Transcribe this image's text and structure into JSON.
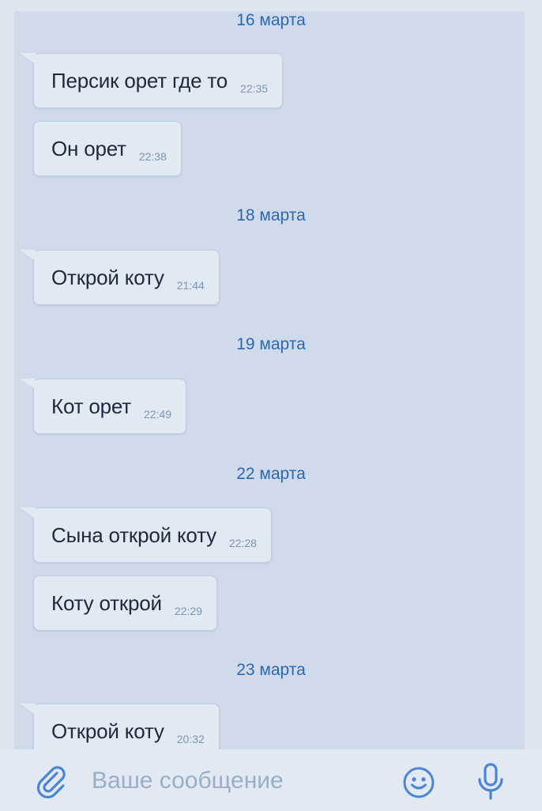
{
  "conversation": {
    "groups": [
      {
        "date": "16 марта",
        "messages": [
          {
            "text": "Персик орет где то",
            "time": "22:35"
          },
          {
            "text": "Он орет",
            "time": "22:38"
          }
        ]
      },
      {
        "date": "18 марта",
        "messages": [
          {
            "text": "Открой коту",
            "time": "21:44"
          }
        ]
      },
      {
        "date": "19 марта",
        "messages": [
          {
            "text": "Кот орет",
            "time": "22:49"
          }
        ]
      },
      {
        "date": "22 марта",
        "messages": [
          {
            "text": "Сына открой коту",
            "time": "22:28"
          },
          {
            "text": "Коту открой",
            "time": "22:29"
          }
        ]
      },
      {
        "date": "23 марта",
        "messages": [
          {
            "text": "Открой коту",
            "time": "20:32"
          }
        ]
      }
    ]
  },
  "composer": {
    "placeholder": "Ваше сообщение",
    "icons": {
      "attach": "paperclip-icon",
      "emoji": "emoji-smile-icon",
      "voice": "microphone-icon"
    }
  },
  "colors": {
    "chat_background": "#cfdbea",
    "bubble_background": "#e1e9f3",
    "date_text": "#2f67ad",
    "message_text": "#1b2a3d",
    "time_text": "#7a95b7",
    "icon_accent": "#4a86d4",
    "placeholder_text": "#99aec8"
  }
}
